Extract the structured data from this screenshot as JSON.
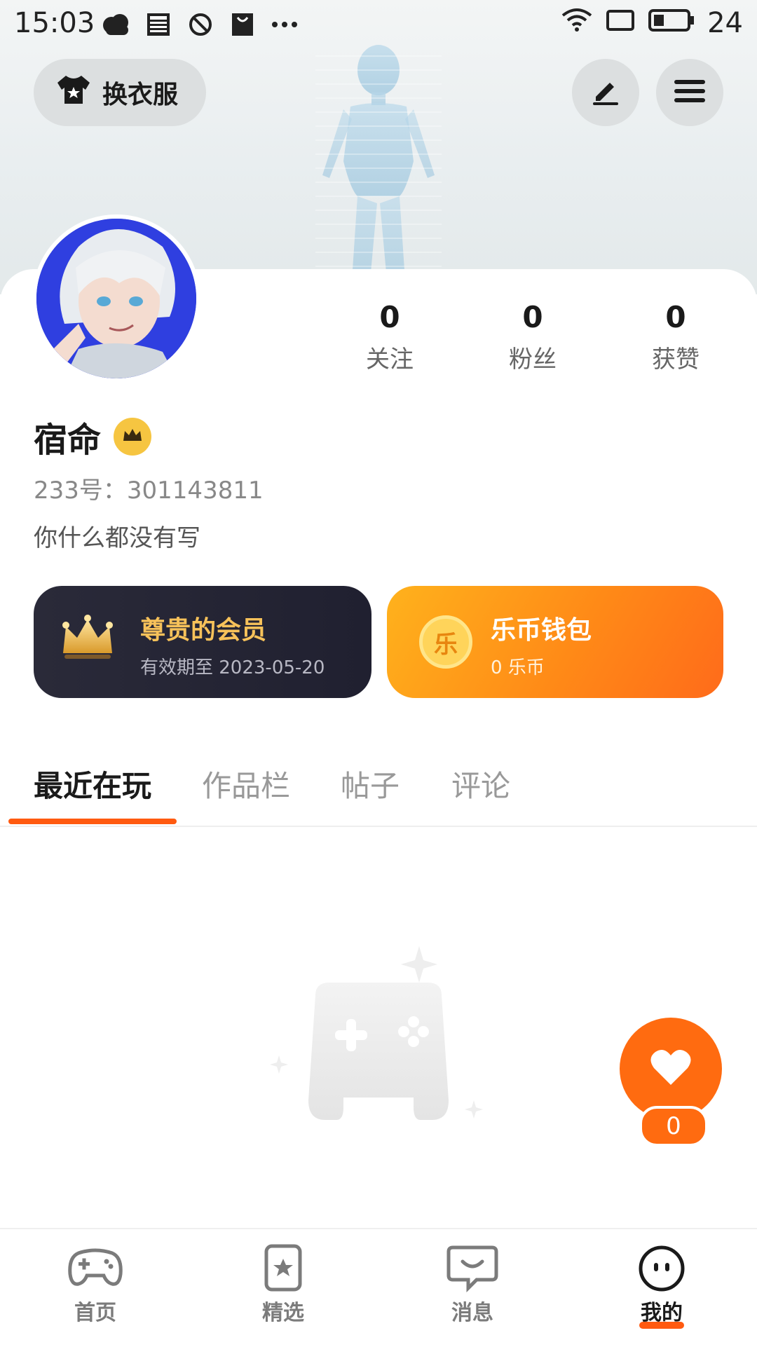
{
  "status_bar": {
    "time": "15:03",
    "battery": "24",
    "left_icons": [
      "weather-icon",
      "news-icon",
      "do-not-disturb-icon",
      "shopping-bag-icon",
      "more-dots-icon"
    ],
    "right_icons": [
      "wifi-icon",
      "screen-rotate-icon",
      "battery-icon"
    ]
  },
  "header": {
    "wardrobe_label": "换衣服",
    "edit_icon": "edit-icon",
    "menu_icon": "menu-icon"
  },
  "profile": {
    "name": "宿命",
    "uid_label": "233号：",
    "uid_value": "301143811",
    "bio": "你什么都没有写",
    "stats": [
      {
        "value": "0",
        "label": "关注"
      },
      {
        "value": "0",
        "label": "粉丝"
      },
      {
        "value": "0",
        "label": "获赞"
      }
    ]
  },
  "vip_card": {
    "title": "尊贵的会员",
    "subtitle": "有效期至 2023-05-20",
    "color": "#2a2a39",
    "title_color": "#f7c25a"
  },
  "wallet_card": {
    "title": "乐币钱包",
    "subtitle": "0 乐币",
    "coin_char": "乐",
    "color": "#ff8a17"
  },
  "tabs": [
    {
      "label": "最近在玩",
      "active": true
    },
    {
      "label": "作品栏",
      "active": false
    },
    {
      "label": "帖子",
      "active": false
    },
    {
      "label": "评论",
      "active": false
    }
  ],
  "like_fab": {
    "count": "0",
    "color": "#ff6b10"
  },
  "bottom_nav": [
    {
      "label": "首页",
      "icon": "gamepad-icon",
      "active": false
    },
    {
      "label": "精选",
      "icon": "featured-star-icon",
      "active": false
    },
    {
      "label": "消息",
      "icon": "message-icon",
      "active": false
    },
    {
      "label": "我的",
      "icon": "profile-face-icon",
      "active": true
    }
  ],
  "accent_color": "#ff5a10"
}
